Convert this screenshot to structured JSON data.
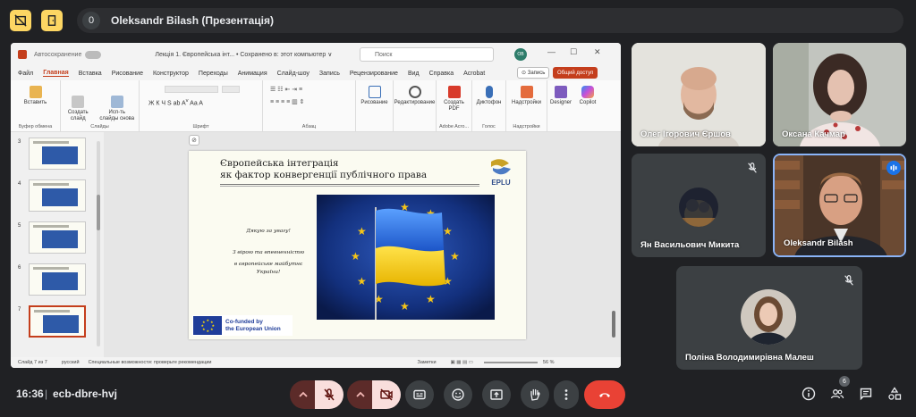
{
  "meeting": {
    "participant_count_badge": "0",
    "presenter_label": "Oleksandr Bilash (Презентація)",
    "clock": "16:36",
    "separator": "|",
    "meeting_code": "ecb-dbre-hvj",
    "people_count": "6"
  },
  "powerpoint": {
    "autosave_label": "Автосохранение",
    "doc_title": "Лекція 1. Європейська інт... • Сохранено в: этот компьютер ∨",
    "search_placeholder": "Поиск",
    "avatar_initials": "OB",
    "menu": [
      "Файл",
      "Главная",
      "Вставка",
      "Рисование",
      "Конструктор",
      "Переходы",
      "Анимация",
      "Слайд-шоу",
      "Запись",
      "Рецензирование",
      "Вид",
      "Справка",
      "Acrobat"
    ],
    "active_menu": "Главная",
    "record_button": "⊙ Запись",
    "share_button": "Общий доступ",
    "ribbon": {
      "paste": "Вставить",
      "clipboard_group": "Буфер обмена",
      "new_slide": "Создать слайд",
      "reuse_slides": "Исп-ть слайды снова",
      "slides_group": "Слайды",
      "font_group": "Шрифт",
      "paragraph_group": "Абзац",
      "drawing": "Рисование",
      "editing": "Редактирование",
      "create_pdf": "Создать PDF",
      "adobe_group": "Adobe Acro...",
      "dictation": "Диктофон",
      "voice_group": "Голос",
      "addins": "Надстройки",
      "addins_group": "Надстройки",
      "designer": "Designer",
      "copilot": "Copilot"
    },
    "thumbnails": [
      {
        "num": "3",
        "selected": false
      },
      {
        "num": "4",
        "selected": false
      },
      {
        "num": "5",
        "selected": false
      },
      {
        "num": "6",
        "selected": false
      },
      {
        "num": "7",
        "selected": true
      }
    ],
    "slide": {
      "title_line1": "Європейська інтеграція",
      "title_line2": "як фактор конвергенції публічного права",
      "logo_text": "EPLU",
      "thanks": "Дякую за увагу!",
      "faith_line1": "З вірою та впевненністю",
      "faith_line2": "в європейське майбутнє",
      "faith_line3": "України!",
      "cofund_line1": "Co-funded by",
      "cofund_line2": "the European Union"
    },
    "status": {
      "slide_of": "Слайд 7 из 7",
      "language": "русский",
      "accessibility": "Специальные возможности: проверьте рекомендации",
      "notes": "Заметки",
      "zoom": "56 %"
    }
  },
  "participants": [
    {
      "name": "Олег Ігорович Єршов",
      "muted": false
    },
    {
      "name": "Оксана Качмар",
      "muted": false
    },
    {
      "name": "Ян Васильович Микита",
      "muted": true
    },
    {
      "name": "Oleksandr Bilash",
      "muted": false,
      "speaking": true
    },
    {
      "name": "Поліна Володимирівна Малеш",
      "muted": true
    }
  ],
  "colors": {
    "background": "#202124",
    "accent_yellow": "#fdd663",
    "hangup_red": "#e94235",
    "ppt_accent": "#c43e1c",
    "active_speaker": "#8ab4f8"
  }
}
